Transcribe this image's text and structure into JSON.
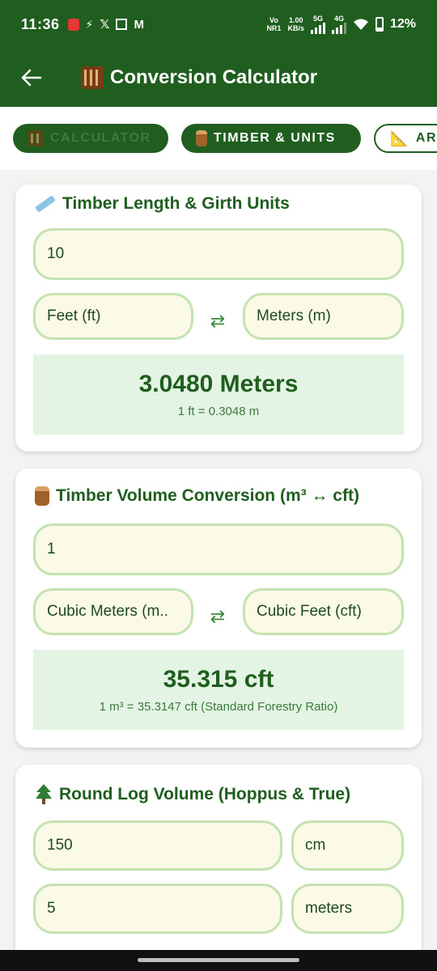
{
  "status": {
    "time": "11:36",
    "carrier_top": "Vo",
    "carrier_bottom": "NR1",
    "speed_top": "1.00",
    "speed_bottom": "KB/s",
    "net1": "5G",
    "net2": "4G",
    "battery": "12%"
  },
  "appbar": {
    "title": "Conversion Calculator"
  },
  "tabs": [
    {
      "label": "CALCULATOR"
    },
    {
      "label": "TIMBER & UNITS"
    },
    {
      "label": "AR"
    }
  ],
  "cards": {
    "length": {
      "title": "Timber Length & Girth Units",
      "input_value": "10",
      "from_unit": "Feet (ft)",
      "to_unit": "Meters (m)",
      "result": "3.0480 Meters",
      "note": "1 ft = 0.3048 m"
    },
    "volume": {
      "title": "Timber Volume Conversion (m³ ↔ cft)",
      "input_value": "1",
      "from_unit": "Cubic Meters (m..",
      "to_unit": "Cubic Feet (cft)",
      "result": "35.315 cft",
      "note": "1 m³ = 35.3147 cft (Standard Forestry Ratio)"
    },
    "roundlog": {
      "title": "Round Log Volume (Hoppus & True)",
      "girth_value": "150",
      "girth_unit": "cm",
      "length_value": "5",
      "length_unit": "meters"
    }
  },
  "colors": {
    "primary": "#1f5e1f",
    "field_bg": "#fafae6",
    "field_border": "#c5e3b2",
    "result_bg": "#e4f4e4"
  }
}
